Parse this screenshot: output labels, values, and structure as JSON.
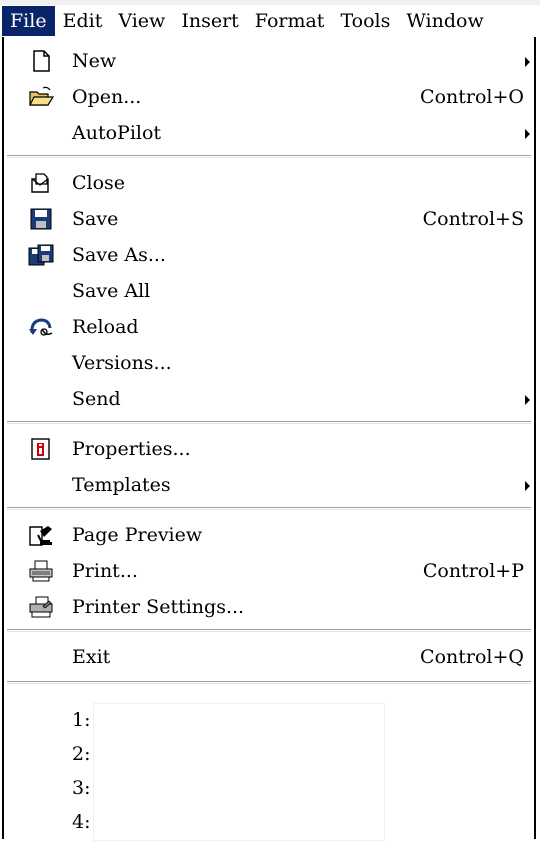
{
  "menubar": {
    "items": [
      "File",
      "Edit",
      "View",
      "Insert",
      "Format",
      "Tools",
      "Window"
    ],
    "active": "File"
  },
  "menu": {
    "items": [
      {
        "label": "New",
        "icon": "new-document-icon",
        "shortcut": "",
        "submenu": true
      },
      {
        "label": "Open...",
        "icon": "open-folder-icon",
        "shortcut": "Control+O",
        "submenu": false
      },
      {
        "label": "AutoPilot",
        "icon": "",
        "shortcut": "",
        "submenu": true
      },
      {
        "label": "Close",
        "icon": "close-document-icon",
        "shortcut": "",
        "submenu": false
      },
      {
        "label": "Save",
        "icon": "save-disk-icon",
        "shortcut": "Control+S",
        "submenu": false
      },
      {
        "label": "Save As...",
        "icon": "save-as-icon",
        "shortcut": "",
        "submenu": false
      },
      {
        "label": "Save All",
        "icon": "",
        "shortcut": "",
        "submenu": false
      },
      {
        "label": "Reload",
        "icon": "reload-icon",
        "shortcut": "",
        "submenu": false
      },
      {
        "label": "Versions...",
        "icon": "",
        "shortcut": "",
        "submenu": false
      },
      {
        "label": "Send",
        "icon": "",
        "shortcut": "",
        "submenu": true
      },
      {
        "label": "Properties...",
        "icon": "properties-icon",
        "shortcut": "",
        "submenu": false
      },
      {
        "label": "Templates",
        "icon": "",
        "shortcut": "",
        "submenu": true
      },
      {
        "label": "Page Preview",
        "icon": "page-preview-icon",
        "shortcut": "",
        "submenu": false
      },
      {
        "label": "Print...",
        "icon": "printer-icon",
        "shortcut": "Control+P",
        "submenu": false
      },
      {
        "label": "Printer Settings...",
        "icon": "printer-settings-icon",
        "shortcut": "",
        "submenu": false
      },
      {
        "label": "Exit",
        "icon": "",
        "shortcut": "Control+Q",
        "submenu": false
      }
    ],
    "recent": [
      "1:",
      "2:",
      "3:",
      "4:"
    ]
  }
}
